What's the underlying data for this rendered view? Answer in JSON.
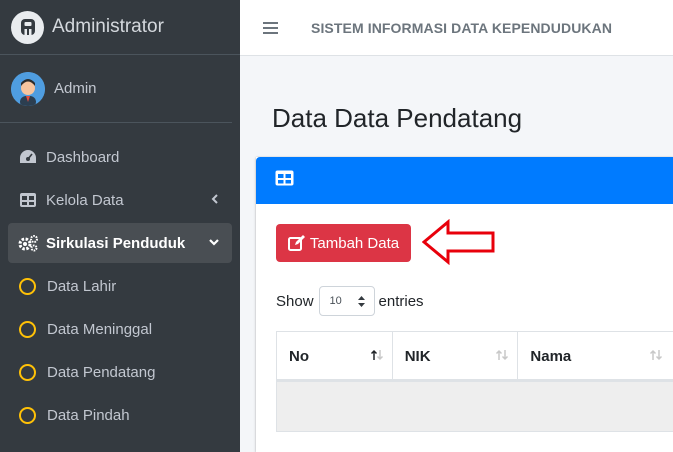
{
  "brand": {
    "text": "Administrator",
    "icon": "app-logo-icon"
  },
  "user": {
    "name": "Admin",
    "icon": "user-avatar-icon"
  },
  "sidebar": {
    "items": [
      {
        "label": "Dashboard",
        "icon": "tachometer-icon"
      },
      {
        "label": "Kelola Data",
        "icon": "table-icon"
      },
      {
        "label": "Sirkulasi Penduduk",
        "icon": "cogs-icon",
        "active": true
      }
    ],
    "sub_items": [
      {
        "label": "Data Lahir",
        "icon": "circle-icon"
      },
      {
        "label": "Data Meninggal",
        "icon": "circle-icon"
      },
      {
        "label": "Data Pendatang",
        "icon": "circle-icon"
      },
      {
        "label": "Data Pindah",
        "icon": "circle-icon"
      }
    ]
  },
  "navbar": {
    "title": "SISTEM INFORMASI DATA KEPENDUDUKAN"
  },
  "page": {
    "title": "Data Data Pendatang"
  },
  "card": {
    "add_button": "Tambah Data",
    "show_label": "Show",
    "entries_value": "10",
    "entries_label": "entries",
    "columns": [
      "No",
      "NIK",
      "Nama"
    ]
  },
  "colors": {
    "sidebar_bg": "#343a40",
    "primary": "#007bff",
    "danger": "#dc3545",
    "warning": "#ffc107",
    "annotation": "#e8000b"
  }
}
